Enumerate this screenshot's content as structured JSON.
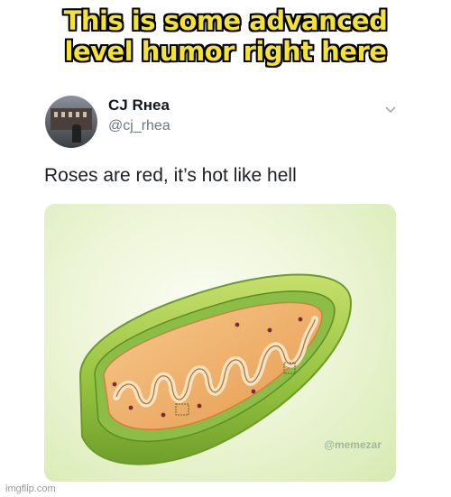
{
  "caption": {
    "line1": "This is some advanced",
    "line2": "level humor right here"
  },
  "tweet": {
    "user_name": "CJ Rнеа",
    "handle": "@cj_rhea",
    "text": "Roses are red, it’s hot like hell",
    "menu_icon": "chevron-down-icon"
  },
  "media": {
    "subject": "mitochondrion illustration",
    "watermark": "@memezar"
  },
  "footer": {
    "imgflip_label": "imgflip.com"
  },
  "colors": {
    "caption_fill": "#f3e23a",
    "caption_stroke": "#000000",
    "handle_gray": "#6b7680"
  }
}
